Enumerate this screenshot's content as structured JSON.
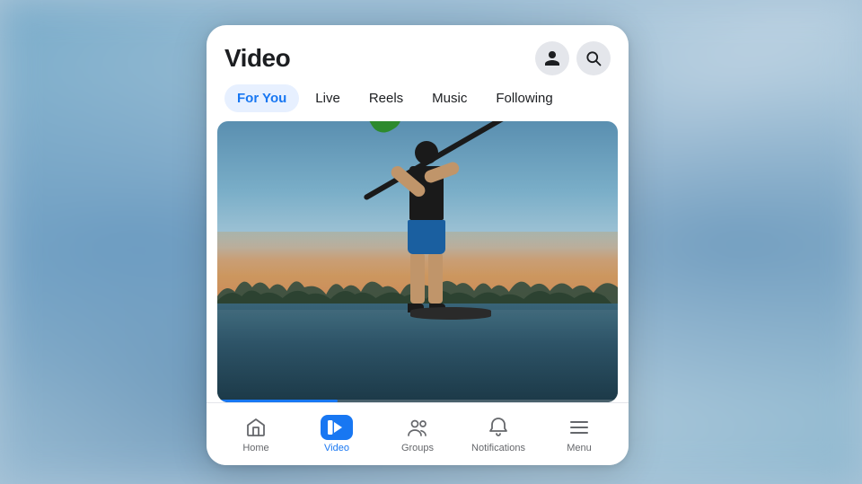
{
  "background": {
    "color": "#a8c4d8"
  },
  "header": {
    "title": "Video",
    "profile_icon": "person-icon",
    "search_icon": "search-icon"
  },
  "tabs": [
    {
      "label": "For You",
      "active": true
    },
    {
      "label": "Live",
      "active": false
    },
    {
      "label": "Reels",
      "active": false
    },
    {
      "label": "Music",
      "active": false
    },
    {
      "label": "Following",
      "active": false
    }
  ],
  "video": {
    "description": "Paddleboarder at sunset on water",
    "progress_percent": 30
  },
  "bottom_nav": [
    {
      "label": "Home",
      "icon": "home-icon",
      "active": false
    },
    {
      "label": "Video",
      "icon": "video-icon",
      "active": true
    },
    {
      "label": "Groups",
      "icon": "groups-icon",
      "active": false
    },
    {
      "label": "Notifications",
      "icon": "bell-icon",
      "active": false
    },
    {
      "label": "Menu",
      "icon": "menu-icon",
      "active": false
    }
  ]
}
